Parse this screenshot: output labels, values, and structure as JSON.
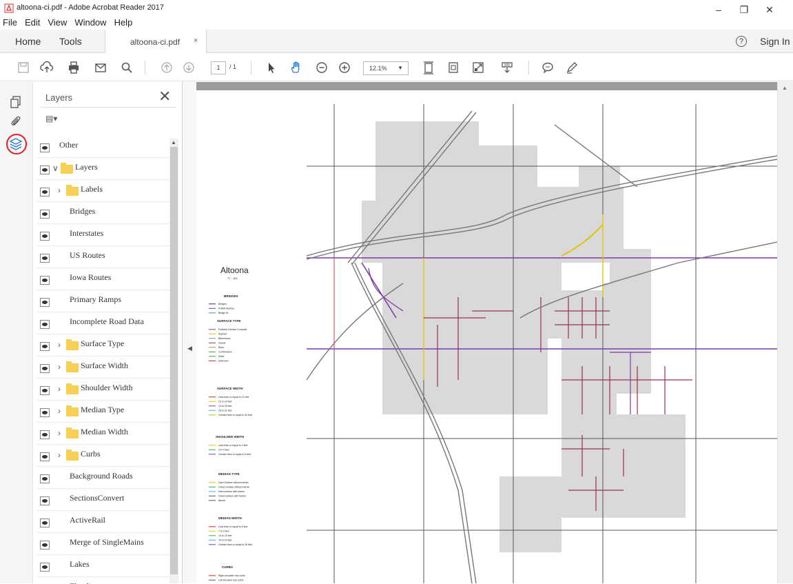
{
  "window": {
    "title": "altoona-ci.pdf - Adobe Acrobat Reader 2017",
    "minimize": "–",
    "restore": "❐",
    "close": "✕"
  },
  "menu": [
    "File",
    "Edit",
    "View",
    "Window",
    "Help"
  ],
  "tabs": {
    "home": "Home",
    "tools": "Tools",
    "document": "altoona-ci.pdf",
    "close": "×"
  },
  "account": {
    "help": "?",
    "sign_in": "Sign In"
  },
  "toolbar": {
    "page_current": "1",
    "page_total": "/ 1",
    "zoom": "12.1%"
  },
  "layers_panel": {
    "title": "Layers",
    "close": "✕",
    "options": "▤▾",
    "rows": [
      {
        "label": "Other",
        "indent": 0,
        "folder": false,
        "chevron": ""
      },
      {
        "label": "Layers",
        "indent": 1,
        "folder": true,
        "chevron": "∨"
      },
      {
        "label": "Labels",
        "indent": 2,
        "folder": true,
        "chevron": "›"
      },
      {
        "label": "Bridges",
        "indent": 3,
        "folder": false,
        "chevron": ""
      },
      {
        "label": "Interstates",
        "indent": 3,
        "folder": false,
        "chevron": ""
      },
      {
        "label": "US Routes",
        "indent": 3,
        "folder": false,
        "chevron": ""
      },
      {
        "label": "Iowa Routes",
        "indent": 3,
        "folder": false,
        "chevron": ""
      },
      {
        "label": "Primary Ramps",
        "indent": 3,
        "folder": false,
        "chevron": ""
      },
      {
        "label": "Incomplete Road Data",
        "indent": 3,
        "folder": false,
        "chevron": ""
      },
      {
        "label": "Surface Type",
        "indent": 2,
        "folder": true,
        "chevron": "›"
      },
      {
        "label": "Surface Width",
        "indent": 2,
        "folder": true,
        "chevron": "›"
      },
      {
        "label": "Shoulder Width",
        "indent": 2,
        "folder": true,
        "chevron": "›"
      },
      {
        "label": "Median Type",
        "indent": 2,
        "folder": true,
        "chevron": "›"
      },
      {
        "label": "Median Width",
        "indent": 2,
        "folder": true,
        "chevron": "›"
      },
      {
        "label": "Curbs",
        "indent": 2,
        "folder": true,
        "chevron": "›"
      },
      {
        "label": "Background Roads",
        "indent": 3,
        "folder": false,
        "chevron": ""
      },
      {
        "label": "SectionsConvert",
        "indent": 3,
        "folder": false,
        "chevron": ""
      },
      {
        "label": "ActiveRail",
        "indent": 3,
        "folder": false,
        "chevron": ""
      },
      {
        "label": "Merge of SingleMains",
        "indent": 3,
        "folder": false,
        "chevron": ""
      },
      {
        "label": "Lakes",
        "indent": 3,
        "folder": false,
        "chevron": ""
      },
      {
        "label": "Flowline",
        "indent": 3,
        "folder": false,
        "chevron": ""
      }
    ]
  },
  "map_legend": {
    "city": "Altoona",
    "code": "77 - 182",
    "bridges_heading": "BRIDGES",
    "bridges_items": [
      "Bridges",
      "FHWA Number",
      "Bridge ID"
    ],
    "surface_type_heading": "SURFACE TYPE",
    "surface_type_items": [
      "Portland Cement Concrete",
      "Asphalt",
      "Bituminous",
      "Gravel",
      "Brick",
      "Combination",
      "Earth",
      "Unknown"
    ],
    "surface_width_heading": "SURFACE WIDTH",
    "surface_width_items": [
      "Less than or equal to 21 feet",
      "22 to 23 feet",
      "24 to 25 feet",
      "26 to 31 feet",
      "Greater than or equal to 32 feet"
    ],
    "shoulder_width_heading": "SHOULDER WIDTH",
    "shoulder_width_items": [
      "Less than or equal to 2 feet",
      "3 to 4 feet",
      "Greater than or equal to 5 feet"
    ],
    "median_type_heading": "MEDIAN TYPE",
    "median_type_items": [
      "Hard Surface without barrier",
      "Grass Surface without barrier",
      "Hard surface with barrier",
      "Grass surface with barrier",
      "Barrier"
    ],
    "median_width_heading": "MEDIAN WIDTH",
    "median_width_items": [
      "Less than or equal to 6 feet",
      "7 to 9 feet",
      "10 to 15 feet",
      "16 to 24 feet",
      "Greater than or equal to 25 feet"
    ],
    "curbs_heading": "CURBS",
    "curbs_items": [
      "Right shoulder has curbs",
      "Left shoulder has curbs"
    ]
  },
  "colors": {
    "accent_blue": "#2d7cd6",
    "highlight_red": "#e02020",
    "map_gray": "#d9d9d9",
    "road_purple": "#7a3aa8",
    "road_yellow": "#e0c400"
  }
}
